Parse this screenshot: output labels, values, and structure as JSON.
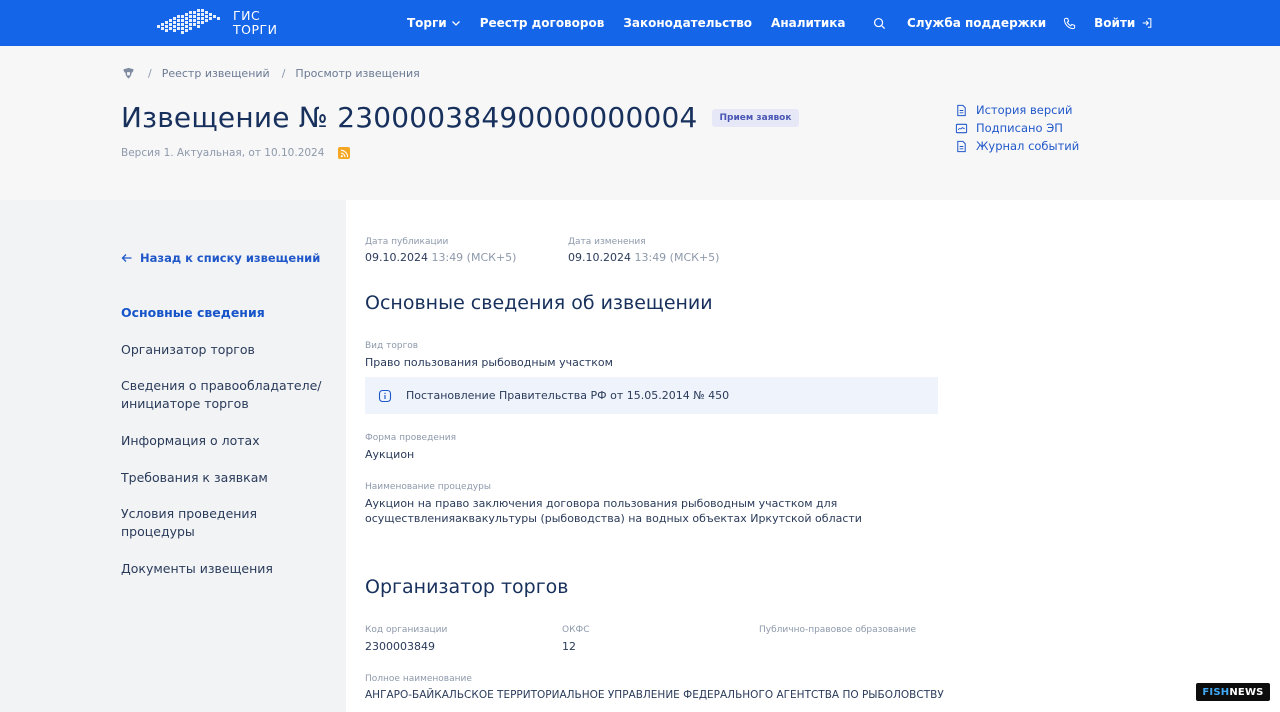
{
  "topbar": {
    "logo_line1": "ГИС",
    "logo_line2": "ТОРГИ",
    "nav": [
      "Торги",
      "Реестр договоров",
      "Законодательство",
      "Аналитика"
    ],
    "support": "Служба поддержки",
    "login": "Войти",
    "icons": [
      "search-icon",
      "phone-icon",
      "login-icon",
      "chevron-down-icon"
    ],
    "bg_color": "#1565e8"
  },
  "breadcrumb": [
    "Реестр извещений",
    "Просмотр извещения"
  ],
  "notice": {
    "title": "Извещение № 23000038490000000004",
    "status": "Прием заявок",
    "version": "Версия 1. Актуальная, от 10.10.2024"
  },
  "side_links": [
    "История версий",
    "Подписано ЭП",
    "Журнал событий"
  ],
  "sidebar": {
    "back": "Назад к списку извещений",
    "menu": [
      "Основные сведения",
      "Организатор торгов",
      "Сведения о правообладателе/ инициаторе торгов",
      "Информация о лотах",
      "Требования к заявкам",
      "Условия проведения процедуры",
      "Документы извещения"
    ]
  },
  "main": {
    "pub_label": "Дата публикации",
    "pub_date": "09.10.2024",
    "pub_time": "13:49 (МСК+5)",
    "mod_label": "Дата изменения",
    "mod_date": "09.10.2024",
    "mod_time": "13:49 (МСК+5)",
    "section1_title": "Основные сведения об извещении",
    "type_label": "Вид торгов",
    "type_value": "Право пользования рыбоводным участком",
    "info_text": "Постановление Правительства РФ от 15.05.2014 № 450",
    "form_label": "Форма проведения",
    "form_value": "Аукцион",
    "name_label": "Наименование процедуры",
    "name_value": "Аукцион на право заключения договора пользования рыбоводным участком для осуществленияаквакультуры (рыбоводства) на водных объектах Иркутской области",
    "section2_title": "Организатор торгов",
    "org_code_label": "Код организации",
    "org_code_value": "2300003849",
    "okfs_label": "ОКФС",
    "okfs_value": "12",
    "ppo_label": "Публично-правовое образование",
    "fullname_label": "Полное наименование",
    "fullname_value": "АНГАРО-БАЙКАЛЬСКОЕ ТЕРРИТОРИАЛЬНОЕ УПРАВЛЕНИЕ ФЕДЕРАЛЬНОГО АГЕНТСТВА ПО РЫБОЛОВСТВУ"
  },
  "watermark": {
    "part1": "FISH",
    "part2": "NEWS"
  }
}
